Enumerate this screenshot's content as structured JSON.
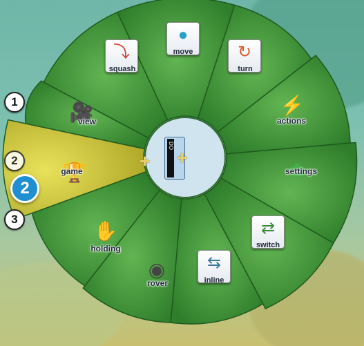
{
  "pie_menu": {
    "items": [
      {
        "key": "squash",
        "label": "squash",
        "icon": "squash-icon"
      },
      {
        "key": "move",
        "label": "move",
        "icon": "move-icon"
      },
      {
        "key": "turn",
        "label": "turn",
        "icon": "turn-icon"
      },
      {
        "key": "actions",
        "label": "actions",
        "icon": "actions-icon"
      },
      {
        "key": "settings",
        "label": "settings",
        "icon": "settings-icon"
      },
      {
        "key": "switch",
        "label": "switch",
        "icon": "switch-icon"
      },
      {
        "key": "inline",
        "label": "inline",
        "icon": "inline-icon"
      },
      {
        "key": "rover",
        "label": "rover",
        "icon": "rover-icon"
      },
      {
        "key": "holding",
        "label": "holding",
        "icon": "holding-icon"
      },
      {
        "key": "game",
        "label": "game",
        "icon": "game-trophy-icon",
        "highlighted": true
      },
      {
        "key": "view",
        "label": "view",
        "icon": "camera-icon"
      }
    ],
    "center_card": "DO",
    "behind_text": "mo"
  },
  "row_numbers": [
    "1",
    "2",
    "3"
  ],
  "callout": "2",
  "colors": {
    "wedge": "#3f9a3a",
    "wedge_dark": "#2f7a2c",
    "highlight": "#c9c43a",
    "callout": "#1e8fd0"
  }
}
